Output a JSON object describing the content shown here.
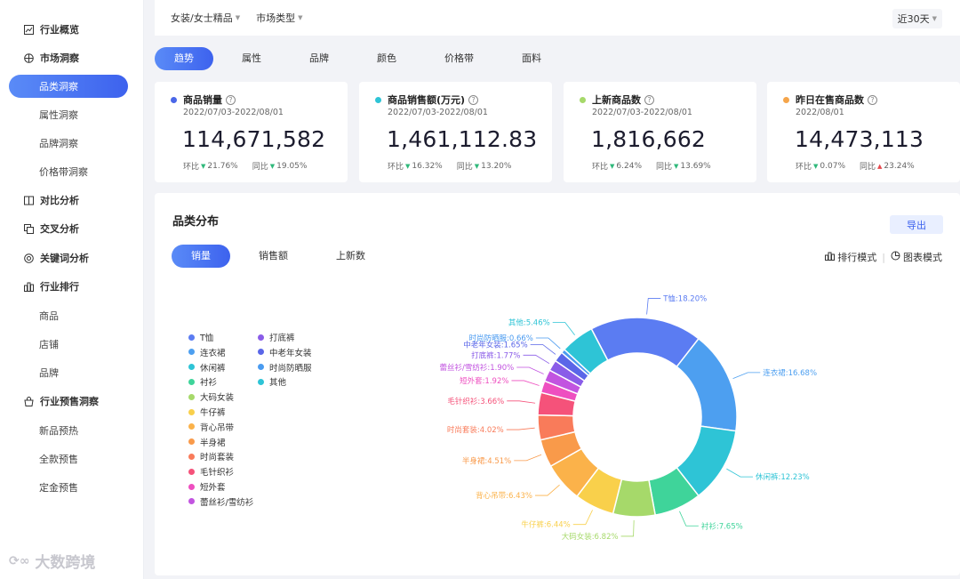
{
  "sidebar": {
    "items": [
      {
        "label": "行业概览",
        "type": "group",
        "icon": "chart-line-icon",
        "active": false
      },
      {
        "label": "市场洞察",
        "type": "group",
        "icon": "globe-icon",
        "active": false
      },
      {
        "label": "品类洞察",
        "type": "sub",
        "active": true
      },
      {
        "label": "属性洞察",
        "type": "sub",
        "active": false
      },
      {
        "label": "品牌洞察",
        "type": "sub",
        "active": false
      },
      {
        "label": "价格带洞察",
        "type": "sub",
        "active": false
      },
      {
        "label": "对比分析",
        "type": "group",
        "icon": "compare-icon",
        "active": false
      },
      {
        "label": "交叉分析",
        "type": "group",
        "icon": "copy-icon",
        "active": false
      },
      {
        "label": "关键词分析",
        "type": "group",
        "icon": "target-icon",
        "active": false
      },
      {
        "label": "行业排行",
        "type": "group",
        "icon": "ranking-icon",
        "active": false
      },
      {
        "label": "商品",
        "type": "sub",
        "active": false
      },
      {
        "label": "店铺",
        "type": "sub",
        "active": false
      },
      {
        "label": "品牌",
        "type": "sub",
        "active": false
      },
      {
        "label": "行业预售洞察",
        "type": "group",
        "icon": "presale-icon",
        "active": false
      },
      {
        "label": "新品预热",
        "type": "sub",
        "active": false
      },
      {
        "label": "全款预售",
        "type": "sub",
        "active": false
      },
      {
        "label": "定金预售",
        "type": "sub",
        "active": false
      }
    ]
  },
  "topbar": {
    "category_filter": "女装/女士精品",
    "market_filter": "市场类型",
    "range": "近30天"
  },
  "tabs": [
    "趋势",
    "属性",
    "品牌",
    "颜色",
    "价格带",
    "面料"
  ],
  "active_tab": 0,
  "cards": [
    {
      "title": "商品销量",
      "color": "#4a67e8",
      "date": "2022/07/03-2022/08/01",
      "value": "114,671,582",
      "mom_label": "环比",
      "mom": "21.76%",
      "mom_dir": "up",
      "yoy_label": "同比",
      "yoy": "19.05%",
      "yoy_dir": "up"
    },
    {
      "title": "商品销售额(万元)",
      "color": "#2ec4d6",
      "date": "2022/07/03-2022/08/01",
      "value": "1,461,112.83",
      "mom_label": "环比",
      "mom": "16.32%",
      "mom_dir": "up",
      "yoy_label": "同比",
      "yoy": "13.20%",
      "yoy_dir": "up"
    },
    {
      "title": "上新商品数",
      "color": "#a6d96a",
      "date": "2022/07/03-2022/08/01",
      "value": "1,816,662",
      "mom_label": "环比",
      "mom": "6.24%",
      "mom_dir": "up",
      "yoy_label": "同比",
      "yoy": "13.69%",
      "yoy_dir": "up"
    },
    {
      "title": "昨日在售商品数",
      "color": "#f5a54a",
      "date": "2022/08/01",
      "value": "14,473,113",
      "mom_label": "环比",
      "mom": "0.07%",
      "mom_dir": "up",
      "yoy_label": "同比",
      "yoy": "23.24%",
      "yoy_dir": "down"
    }
  ],
  "panel": {
    "title": "品类分布",
    "export_label": "导出",
    "sub_tabs": [
      "销量",
      "销售额",
      "上新数"
    ],
    "active_sub_tab": 0,
    "rank_mode": "排行模式",
    "chart_mode": "图表模式"
  },
  "chart_data": {
    "type": "pie",
    "variant": "donut",
    "series": [
      {
        "name": "T恤",
        "value": 18.2,
        "label": "T恤:18.20%",
        "color": "#5b7cf2"
      },
      {
        "name": "连衣裙",
        "value": 16.68,
        "label": "连衣裙:16.68%",
        "color": "#4d9ff0"
      },
      {
        "name": "休闲裤",
        "value": 12.23,
        "label": "休闲裤:12.23%",
        "color": "#2ec4d6"
      },
      {
        "name": "衬衫",
        "value": 7.65,
        "label": "衬衫:7.65%",
        "color": "#3fd49a"
      },
      {
        "name": "大码女装",
        "value": 6.82,
        "label": "大码女装:6.82%",
        "color": "#a6d96a"
      },
      {
        "name": "牛仔裤",
        "value": 6.44,
        "label": "牛仔裤:6.44%",
        "color": "#f9d04b"
      },
      {
        "name": "背心吊带",
        "value": 6.43,
        "label": "背心吊带:6.43%",
        "color": "#fbb24a"
      },
      {
        "name": "半身裙",
        "value": 4.51,
        "label": "半身裙:4.51%",
        "color": "#f99a4a"
      },
      {
        "name": "时尚套装",
        "value": 4.02,
        "label": "时尚套装:4.02%",
        "color": "#f97b5a"
      },
      {
        "name": "毛针织衫",
        "value": 3.66,
        "label": "毛针织衫:3.66%",
        "color": "#f5527a"
      },
      {
        "name": "短外套",
        "value": 1.92,
        "label": "短外套:1.92%",
        "color": "#ee4fc0"
      },
      {
        "name": "蕾丝衫/雪纺衫",
        "value": 1.9,
        "label": "蕾丝衫/雪纺衫:1.90%",
        "color": "#c254e0"
      },
      {
        "name": "打底裤",
        "value": 1.77,
        "label": "打底裤:1.77%",
        "color": "#8a5ce8"
      },
      {
        "name": "中老年女装",
        "value": 1.65,
        "label": "中老年女装:1.65%",
        "color": "#5a66e8"
      },
      {
        "name": "时尚防晒服",
        "value": 0.66,
        "label": "时尚防晒服:0.66%",
        "color": "#4a9bf0"
      },
      {
        "name": "其他",
        "value": 5.46,
        "label": "其他:5.46%",
        "color": "#2ec4d6"
      }
    ],
    "legend_order": [
      "T恤",
      "连衣裙",
      "休闲裤",
      "衬衫",
      "大码女装",
      "牛仔裤",
      "背心吊带",
      "半身裙",
      "时尚套装",
      "毛针织衫",
      "短外套",
      "蕾丝衫/雪纺衫",
      "打底裤",
      "中老年女装",
      "时尚防晒服",
      "其他"
    ],
    "legend_placement": "left"
  },
  "watermark": "大数跨境"
}
